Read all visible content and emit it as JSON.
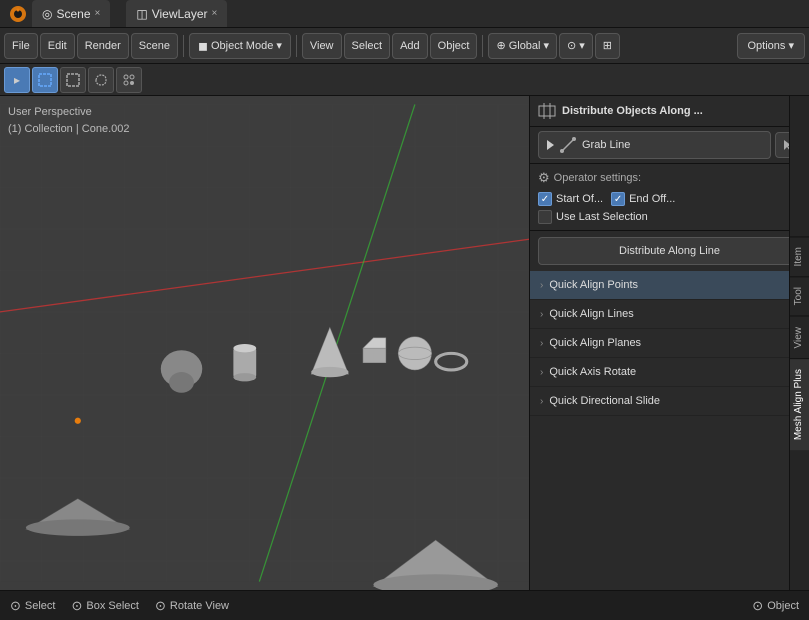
{
  "titleBar": {
    "leftTab": {
      "icon": "◎",
      "label": "Scene",
      "closeBtn": "×"
    },
    "rightTab": {
      "icon": "◫",
      "label": "ViewLayer",
      "closeBtn": "×"
    }
  },
  "toolbar": {
    "mode": "Object Mode",
    "menus": [
      "File",
      "Edit",
      "Render",
      "Scene"
    ],
    "view": "View",
    "select": "Select",
    "add": "Add",
    "object": "Object",
    "transform": "Global",
    "options": "Options ▾"
  },
  "headerTools": {
    "selectTools": [
      "▸",
      "□",
      "⬜",
      "⬡",
      "⊕"
    ]
  },
  "viewport": {
    "label": "User Perspective",
    "sublabel": "(1) Collection | Cone.002"
  },
  "rightPanel": {
    "title": "Distribute Objects Along ...",
    "grabLine": "Grab Line",
    "operatorSettings": "Operator settings:",
    "startOffset": "Start Of...",
    "endOffset": "End Off...",
    "startChecked": true,
    "endChecked": true,
    "useLastSelection": "Use Last Selection",
    "useLastChecked": false,
    "distributeBtn": "Distribute Along Line",
    "menuItems": [
      {
        "label": "Quick Align Points",
        "highlighted": true
      },
      {
        "label": "Quick Align Lines",
        "highlighted": false
      },
      {
        "label": "Quick Align Planes",
        "highlighted": false
      },
      {
        "label": "Quick Axis Rotate",
        "highlighted": false
      },
      {
        "label": "Quick Directional Slide",
        "highlighted": false
      }
    ]
  },
  "rightTabs": [
    "Item",
    "Tool",
    "View",
    "Mesh Align Plus"
  ],
  "statusBar": {
    "items": [
      {
        "icon": "⊙",
        "label": "Select"
      },
      {
        "icon": "⊙",
        "label": "Box Select"
      },
      {
        "icon": "⊙",
        "label": "Rotate View"
      },
      {
        "icon": "⊙",
        "label": "Object"
      }
    ]
  }
}
